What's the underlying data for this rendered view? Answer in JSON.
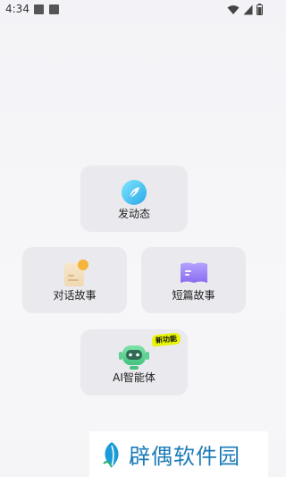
{
  "status_bar": {
    "time": "4:34"
  },
  "cards": {
    "post": {
      "label": "发动态",
      "icon": "feather-bubble-icon"
    },
    "dialog_story": {
      "label": "对话故事",
      "icon": "chat-notes-icon"
    },
    "short_story": {
      "label": "短篇故事",
      "icon": "open-book-icon"
    },
    "ai_agent": {
      "label": "AI智能体",
      "icon": "robot-icon",
      "badge": "新功能"
    }
  },
  "watermark": {
    "text": "辟偶软件园"
  },
  "colors": {
    "card_bg": "#e9e9ee",
    "badge_bg": "#e8f500",
    "watermark_text": "#1b7bb8"
  }
}
